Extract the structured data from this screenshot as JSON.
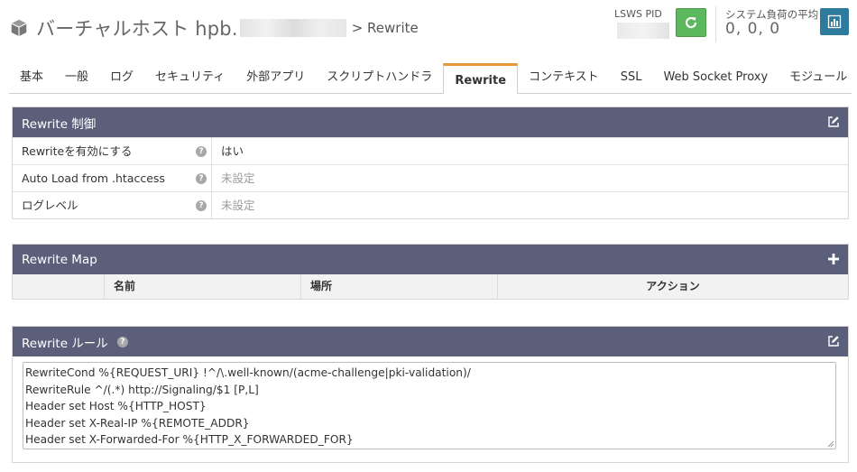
{
  "header": {
    "title_prefix": "バーチャルホスト hpb.",
    "breadcrumb": "> Rewrite",
    "pid_label": "LSWS PID",
    "load_label": "システム負荷の平均",
    "load_value": "0, 0, 0"
  },
  "tabs": [
    "基本",
    "一般",
    "ログ",
    "セキュリティ",
    "外部アプリ",
    "スクリプトハンドラ",
    "Rewrite",
    "コンテキスト",
    "SSL",
    "Web Socket Proxy",
    "モジュール"
  ],
  "active_tab": "Rewrite",
  "rewrite_control": {
    "title": "Rewrite 制御",
    "rows": [
      {
        "label": "Rewriteを有効にする",
        "value": "はい"
      },
      {
        "label": "Auto Load from .htaccess",
        "value": "未設定"
      },
      {
        "label": "ログレベル",
        "value": "未設定"
      }
    ]
  },
  "rewrite_map": {
    "title": "Rewrite Map",
    "columns": [
      "名前",
      "場所",
      "アクション"
    ]
  },
  "rewrite_rules": {
    "title": "Rewrite ルール",
    "lines": "RewriteCond %{REQUEST_URI} !^/\\.well-known/(acme-challenge|pki-validation)/\nRewriteRule ^/(.*) http://Signaling/$1 [P,L]\nHeader set Host %{HTTP_HOST}\nHeader set X-Real-IP %{REMOTE_ADDR}\nHeader set X-Forwarded-For %{HTTP_X_FORWARDED_FOR}"
  },
  "colors": {
    "panel_header": "#5b5f7a",
    "restart_button": "#5cb85c",
    "stats_button": "#2f7b9e",
    "active_tab_accent": "#e8963a"
  }
}
